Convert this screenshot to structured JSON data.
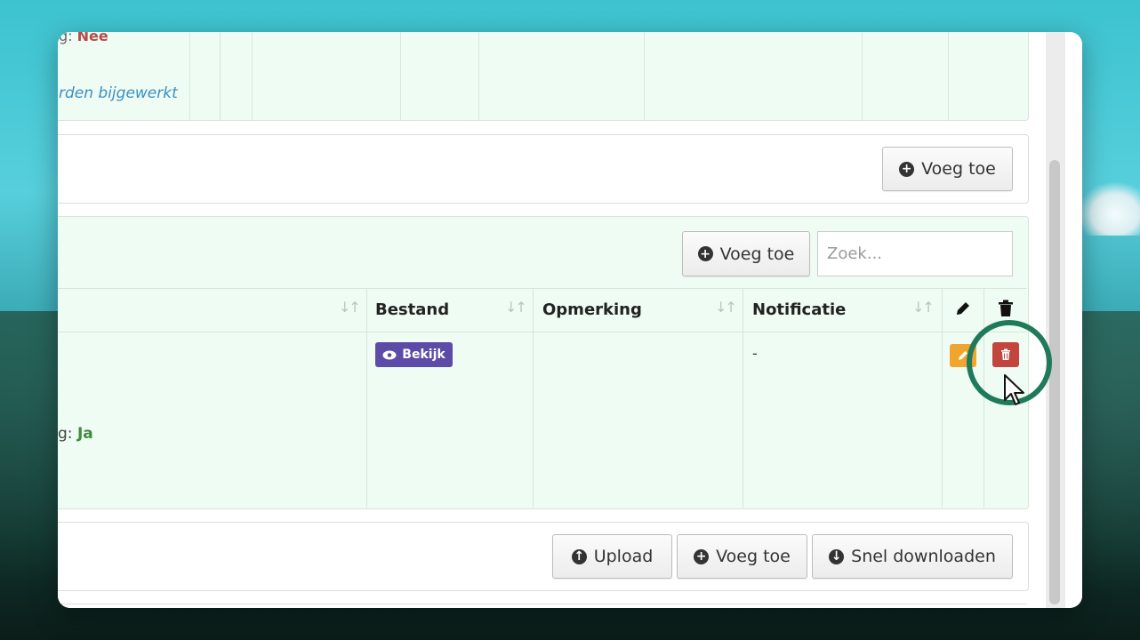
{
  "top_section": {
    "label_fragment": "g:",
    "label_value": "Nee",
    "status_text": "rden bijgewerkt"
  },
  "section_add": {
    "add_label": "Voeg toe"
  },
  "documents": {
    "add_label": "Voeg toe",
    "search_placeholder": "Zoek...",
    "columns": {
      "bestand": "Bestand",
      "opmerking": "Opmerking",
      "notificatie": "Notificatie"
    },
    "row": {
      "label_fragment": "g:",
      "label_value": "Ja",
      "bekijk_label": "Bekijk",
      "opmerking": "",
      "notificatie": "-"
    }
  },
  "bottom_actions": {
    "upload_label": "Upload",
    "add_label": "Voeg toe",
    "download_label": "Snel downloaden"
  },
  "colors": {
    "accent_green": "#1f7a5c",
    "delete_red": "#c4453d",
    "edit_orange": "#f0a62c",
    "view_purple": "#5e4ba8",
    "panel_green": "#eefcf4"
  },
  "icons": [
    "plus-circle-icon",
    "sort-icon",
    "pencil-icon",
    "trash-icon",
    "eye-icon",
    "upload-icon",
    "download-icon",
    "cursor-icon"
  ]
}
